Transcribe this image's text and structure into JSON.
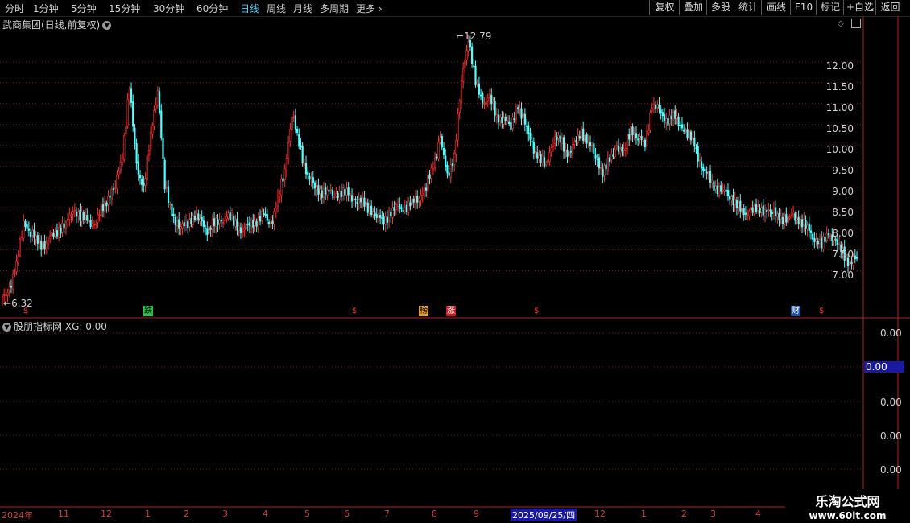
{
  "toolbar": {
    "periods": [
      "分时",
      "1分钟",
      "5分钟",
      "15分钟",
      "30分钟",
      "60分钟",
      "日线",
      "周线",
      "月线",
      "多周期",
      "更多"
    ],
    "active_period": "日线",
    "right_buttons": [
      "复权",
      "叠加",
      "多股",
      "统计",
      "画线",
      "F10",
      "标记",
      "+自选",
      "返回"
    ]
  },
  "main_panel": {
    "title": "武商集团(日线,前复权)",
    "price_ticks": [
      "12.00",
      "11.50",
      "11.00",
      "10.50",
      "10.00",
      "9.50",
      "9.00",
      "8.50",
      "8.00",
      "7.50",
      "7.00"
    ],
    "high_marker": "12.79",
    "low_marker": "6.32",
    "events": [
      "$",
      "跌",
      "$",
      "榜",
      "涨",
      "$",
      "财",
      "$"
    ]
  },
  "indicator_panel": {
    "title": "股朋指标网",
    "xg_text": "XG: 0.00",
    "ticks": [
      "0.00",
      "0.00",
      "0.00",
      "0.00",
      "0.00"
    ],
    "current_value": "0.00"
  },
  "date_axis": {
    "labels": [
      "2024年",
      "11",
      "12",
      "1",
      "2",
      "3",
      "4",
      "5",
      "6",
      "7",
      "8",
      "9",
      "2025/09/25/四",
      "12",
      "1",
      "2",
      "3",
      "4"
    ]
  },
  "watermark": {
    "name": "乐淘公式网",
    "url": "www.60lt.com"
  },
  "colors": {
    "up": "#ff3232",
    "down": "#54ffff",
    "grid": "#7a1a1a",
    "active_tab": "#4fd0ff"
  },
  "chart_data": {
    "type": "candlestick",
    "ylim": [
      6.2,
      12.9
    ],
    "close_path": [
      6.32,
      6.6,
      7.1,
      8.2,
      7.9,
      7.7,
      7.6,
      7.8,
      8.0,
      8.1,
      8.5,
      8.3,
      8.2,
      8.1,
      8.4,
      8.8,
      9.0,
      9.8,
      11.4,
      9.5,
      9.0,
      10.2,
      11.4,
      9.0,
      8.4,
      8.0,
      8.1,
      8.3,
      8.2,
      8.0,
      8.1,
      8.2,
      8.3,
      8.1,
      8.0,
      8.1,
      8.2,
      8.3,
      8.1,
      8.7,
      9.4,
      10.8,
      10.0,
      9.4,
      9.0,
      8.9,
      8.9,
      8.8,
      8.9,
      8.8,
      8.7,
      8.6,
      8.5,
      8.3,
      8.2,
      8.4,
      8.5,
      8.5,
      8.6,
      8.8,
      9.0,
      9.5,
      10.2,
      9.2,
      9.8,
      11.5,
      12.6,
      11.5,
      11.0,
      11.2,
      10.6,
      10.7,
      10.4,
      11.0,
      10.5,
      10.0,
      9.7,
      9.5,
      10.2,
      10.1,
      9.8,
      10.0,
      10.3,
      10.1,
      9.7,
      9.4,
      9.6,
      10.0,
      9.8,
      10.4,
      10.2,
      10.0,
      11.0,
      10.8,
      10.6,
      10.7,
      10.5,
      10.3,
      10.0,
      9.5,
      9.2,
      9.0,
      8.9,
      8.8,
      8.6,
      8.3,
      8.5,
      8.4,
      8.5,
      8.4,
      8.3,
      8.2,
      8.3,
      8.2,
      8.0,
      7.8,
      7.6,
      7.9,
      7.7,
      7.4,
      7.2,
      7.3
    ]
  }
}
